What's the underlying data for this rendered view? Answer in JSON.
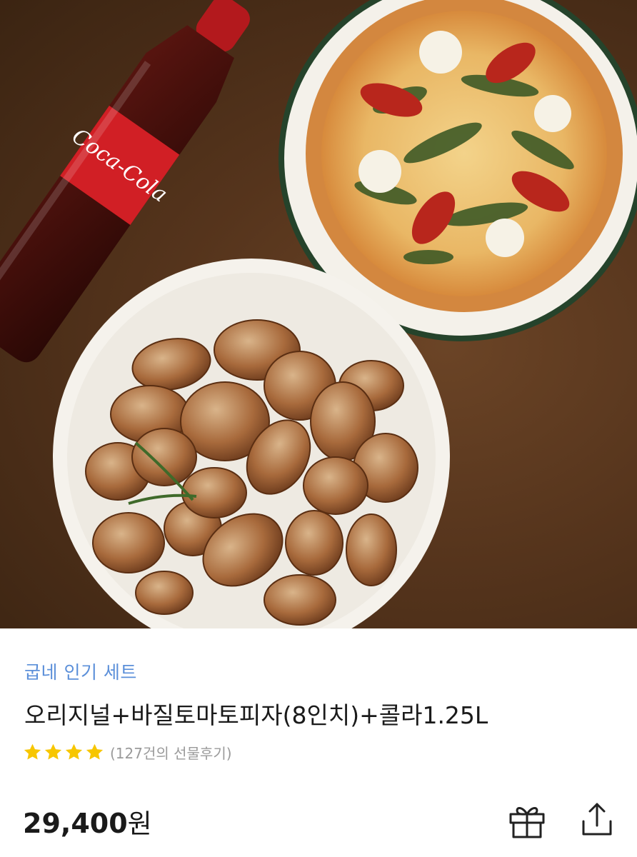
{
  "product": {
    "brand": "굽네 인기 세트",
    "title": "오리지널+바질토마토피자(8인치)+콜라1.25L",
    "rating_stars": 4,
    "review_text": "(127건의 선물후기)",
    "price_number": "29,400",
    "price_unit": "원",
    "bottle_label": "Coca-Cola"
  },
  "colors": {
    "brand": "#5b8fd9",
    "star": "#f7c600",
    "table": "#55341c"
  },
  "icons": {
    "gift": "gift-icon",
    "share": "share-icon"
  }
}
